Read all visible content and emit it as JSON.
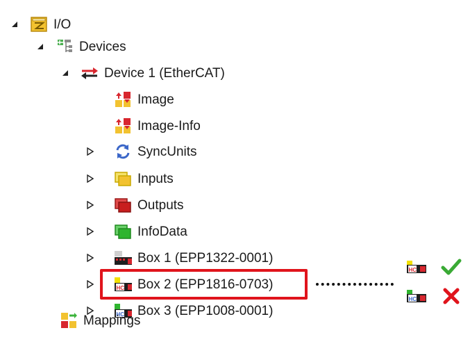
{
  "tree": {
    "items": [
      {
        "label": "I/O",
        "icon": "io-folder-icon",
        "arrow": "expanded"
      },
      {
        "label": "Devices",
        "icon": "devices-tree-icon",
        "arrow": "expanded"
      },
      {
        "label": "Device 1 (EtherCAT)",
        "icon": "ethercat-device-icon",
        "arrow": "expanded"
      },
      {
        "label": "Image",
        "icon": "image-icon",
        "arrow": "none"
      },
      {
        "label": "Image-Info",
        "icon": "image-info-icon",
        "arrow": "none"
      },
      {
        "label": "SyncUnits",
        "icon": "sync-units-icon",
        "arrow": "collapsed"
      },
      {
        "label": "Inputs",
        "icon": "inputs-icon",
        "arrow": "collapsed"
      },
      {
        "label": "Outputs",
        "icon": "outputs-icon",
        "arrow": "collapsed"
      },
      {
        "label": "InfoData",
        "icon": "infodata-icon",
        "arrow": "collapsed"
      },
      {
        "label": "Box 1 (EPP1322-0001)",
        "icon": "box-icon",
        "arrow": "collapsed"
      },
      {
        "label": "Box 2 (EPP1816-0703)",
        "icon": "box-hc-icon",
        "arrow": "collapsed"
      },
      {
        "label": "Box 3 (EPP1008-0001)",
        "icon": "box-hc-icon",
        "arrow": "collapsed"
      },
      {
        "label": "Mappings",
        "icon": "mappings-icon",
        "arrow": "none"
      }
    ]
  },
  "legend": {
    "correct": {
      "icon": "box-hc-icon",
      "mark": "checkmark-icon",
      "color": "#3aaa35"
    },
    "wrong": {
      "icon": "box-hc-icon",
      "mark": "cross-icon",
      "color": "#e0141c"
    }
  },
  "colors": {
    "highlight": "#e0141c",
    "folder_yellow": "#f2c230",
    "red": "#d8262e",
    "green": "#3cb43c",
    "blue": "#3a66c8"
  }
}
